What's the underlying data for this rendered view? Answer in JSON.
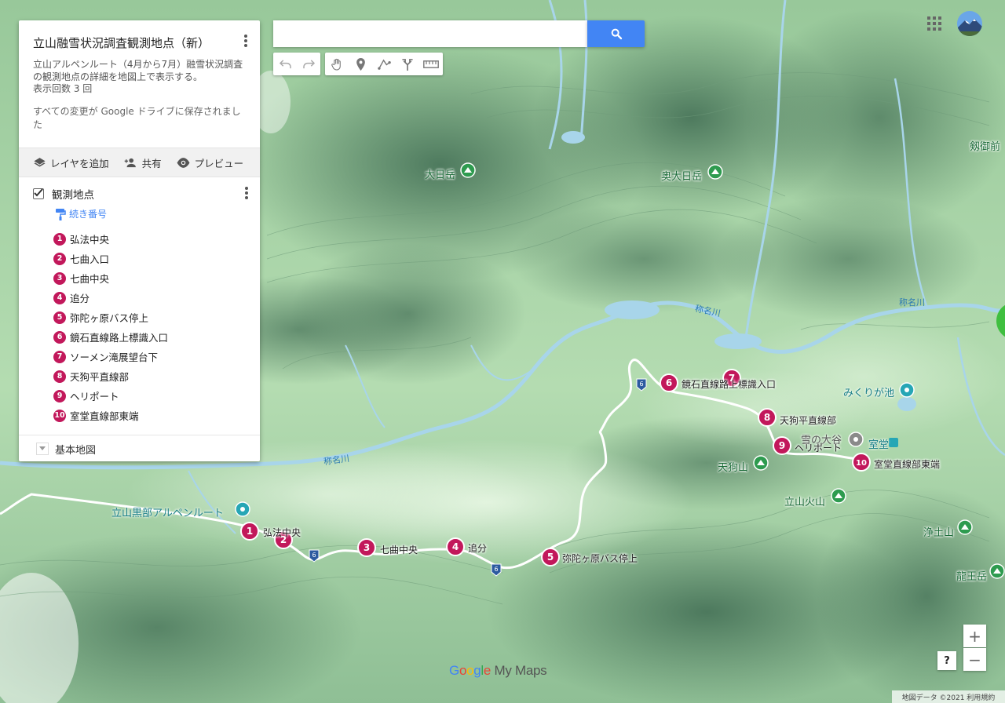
{
  "panel": {
    "title": "立山融雪状況調査観測地点（新）",
    "description": "立山アルペンルート（4月から7月）融雪状況調査の観測地点の詳細を地図上で表示する。",
    "views": "表示回数 3 回",
    "saved": "すべての変更が Google ドライブに保存されました",
    "actions": {
      "add_layer": "レイヤを追加",
      "share": "共有",
      "preview": "プレビュー"
    },
    "layer": {
      "title": "観測地点",
      "style": "続き番号",
      "points": [
        {
          "num": "1",
          "label": "弘法中央"
        },
        {
          "num": "2",
          "label": "七曲入口"
        },
        {
          "num": "3",
          "label": "七曲中央"
        },
        {
          "num": "4",
          "label": "追分"
        },
        {
          "num": "5",
          "label": "弥陀ヶ原バス停上"
        },
        {
          "num": "6",
          "label": "鏡石直線路上標識入口"
        },
        {
          "num": "7",
          "label": "ソーメン滝展望台下"
        },
        {
          "num": "8",
          "label": "天狗平直線部"
        },
        {
          "num": "9",
          "label": "ヘリポート"
        },
        {
          "num": "10",
          "label": "室堂直線部東端"
        }
      ]
    },
    "basemap": "基本地図"
  },
  "map_labels": {
    "peaks": [
      "大日岳",
      "奥大日岳",
      "天狗山",
      "立山火山",
      "浄土山",
      "龍王岳",
      "剱御前"
    ],
    "rivers": [
      "称名川"
    ],
    "pois": [
      "立山黒部アルペンルート",
      "みくりが池",
      "雪の大谷",
      "室堂"
    ],
    "route_badge": "6",
    "marker_labels": [
      "弘法中央",
      "七曲中央",
      "追分",
      "弥陀ヶ原バス停上",
      "鏡石直線路上標識入口",
      "天狗平直線部",
      "ヘリポート",
      "室堂直線部東端"
    ]
  },
  "footer": "地図データ ©2021 利用規約",
  "logo": {
    "google": "Google",
    "mymaps": "My Maps"
  },
  "help": "?",
  "colors": {
    "marker": "#c2185b",
    "accent": "#4285f4",
    "peak": "#2e9b4f",
    "poi": "#26a6b5"
  }
}
